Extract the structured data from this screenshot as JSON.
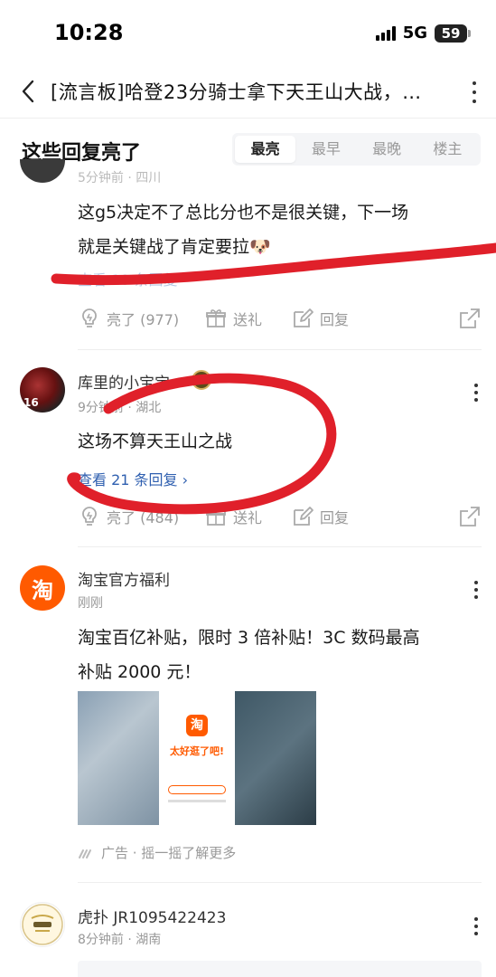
{
  "status_bar": {
    "time": "10:28",
    "network": "5G",
    "battery": "59"
  },
  "nav": {
    "title": "[流言板]哈登23分骑士拿下天王山大战，…"
  },
  "section": {
    "title": "这些回复亮了",
    "sort_tabs": [
      "最亮",
      "最早",
      "最晚",
      "楼主"
    ],
    "active_tab": "最亮"
  },
  "comments": [
    {
      "meta": "5分钟前 · 四川",
      "text_line1": "这g5决定不了总比分也不是很关键，下一场",
      "text_line2": "就是关键战了肯定要拉🐶",
      "replies": "查看 10 条回复",
      "light": "亮了 (977)",
      "gift": "送礼",
      "reply": "回复"
    },
    {
      "username": "库里的小宝宝",
      "meta": "9分钟前 · 湖北",
      "text": "这场不算天王山之战",
      "replies": "查看 21 条回复 ›",
      "light": "亮了 (484)",
      "gift": "送礼",
      "reply": "回复"
    }
  ],
  "ad": {
    "username": "淘宝官方福利",
    "avatar_glyph": "淘",
    "meta": "刚刚",
    "text_line1": "淘宝百亿补贴，限时 3 倍补贴！3C 数码最高",
    "text_line2": "补贴 2000 元！",
    "image_logo": "淘",
    "image_slogan": "太好逛了吧!",
    "footer": "广告 · 摇一摇了解更多"
  },
  "last_comment": {
    "username": "虎扑 JR1095422423",
    "meta": "8分钟前 · 湖南"
  },
  "colors": {
    "accent_orange": "#ff5a00",
    "link_blue": "#3060b0",
    "scribble_red": "#e0202a"
  }
}
